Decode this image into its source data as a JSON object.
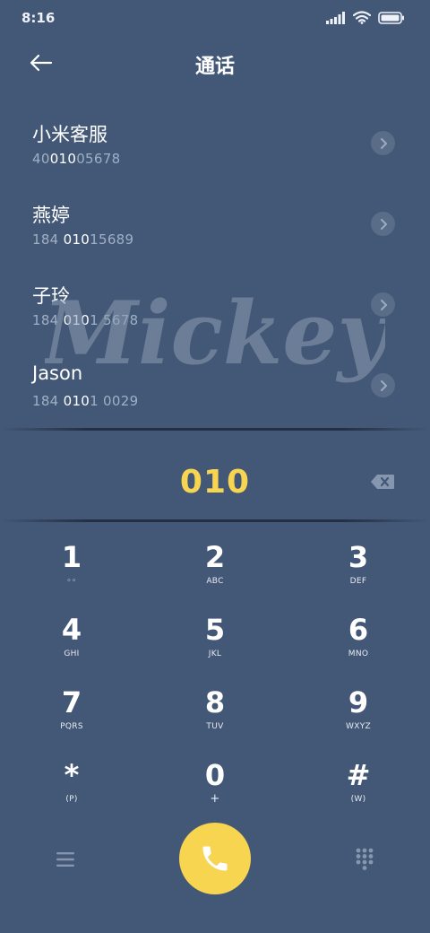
{
  "status": {
    "time": "8:16",
    "icons": [
      "signal-icon",
      "wifi-icon",
      "battery-icon"
    ]
  },
  "header": {
    "title": "通话",
    "back_icon": "back-arrow-icon"
  },
  "contacts": [
    {
      "name": "小米客服",
      "number_parts": [
        "40",
        "010",
        "05678"
      ]
    },
    {
      "name": "燕婷",
      "number_parts": [
        "184 ",
        "010",
        "15689"
      ]
    },
    {
      "name": "子玲",
      "number_parts": [
        "184 ",
        "010",
        "1 5678"
      ]
    },
    {
      "name": "Jason",
      "number_parts": [
        "184 ",
        "010",
        "1 0029"
      ]
    }
  ],
  "watermark": {
    "text": "Mickey"
  },
  "dialer": {
    "input": "010",
    "backspace_icon": "backspace-icon"
  },
  "keypad": [
    {
      "digit": "1",
      "letters": "◦◦"
    },
    {
      "digit": "2",
      "letters": "ABC"
    },
    {
      "digit": "3",
      "letters": "DEF"
    },
    {
      "digit": "4",
      "letters": "GHI"
    },
    {
      "digit": "5",
      "letters": "JKL"
    },
    {
      "digit": "6",
      "letters": "MNO"
    },
    {
      "digit": "7",
      "letters": "PQRS"
    },
    {
      "digit": "8",
      "letters": "TUV"
    },
    {
      "digit": "9",
      "letters": "WXYZ"
    },
    {
      "digit": "*",
      "letters": "(P)"
    },
    {
      "digit": "0",
      "letters": "+"
    },
    {
      "digit": "#",
      "letters": "(W)"
    }
  ],
  "bottom": {
    "menu_icon": "menu-icon",
    "call_icon": "phone-icon",
    "keypad_icon": "keypad-icon"
  },
  "colors": {
    "background": "#435876",
    "accent": "#f7d550",
    "secondary_text": "#9fb0c6"
  }
}
